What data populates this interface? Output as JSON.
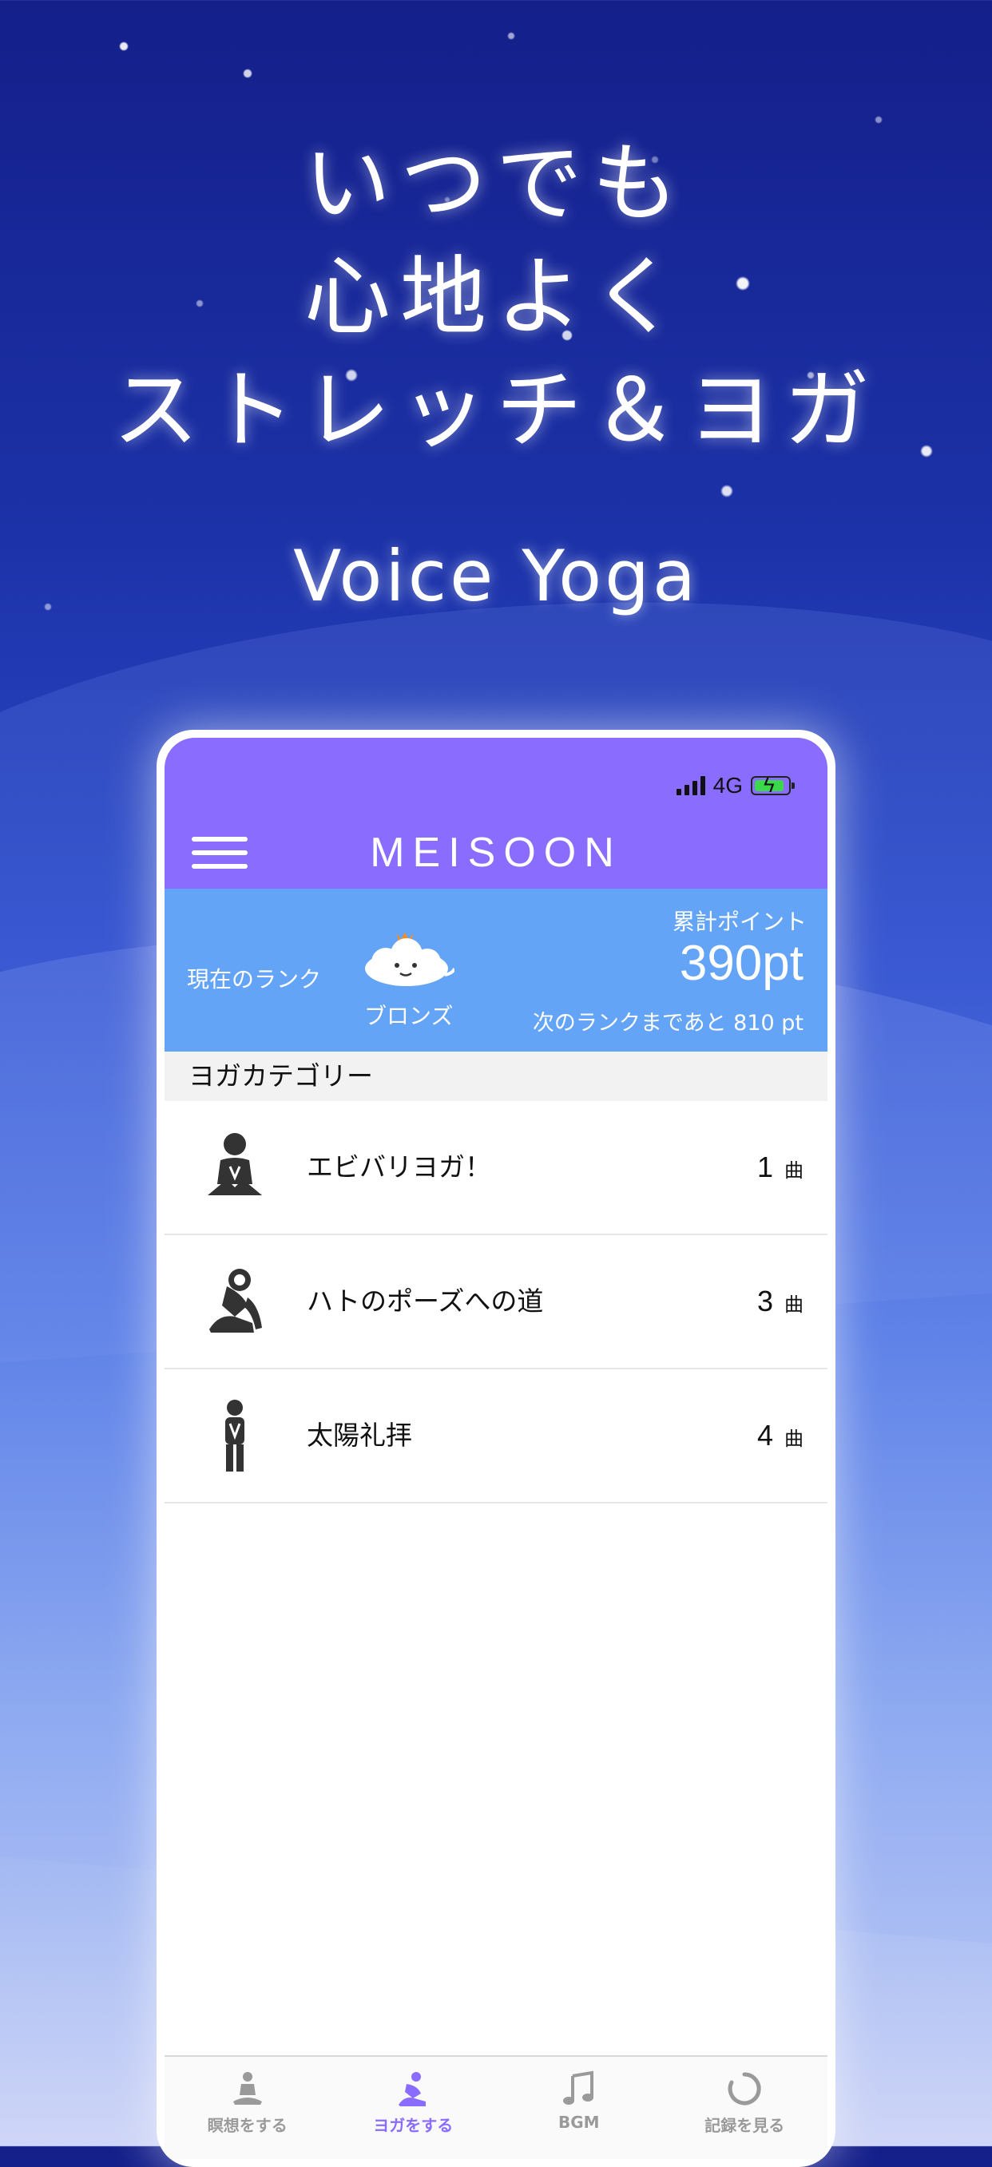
{
  "promo": {
    "headline_lines": [
      "いつでも",
      "心地よく",
      "ストレッチ＆ヨガ"
    ],
    "subtitle": "Voice Yoga"
  },
  "status_bar": {
    "network": "4G"
  },
  "app": {
    "title": "MEISOON",
    "accent_color": "#8a6cff",
    "rank_panel_color": "#64a4f7"
  },
  "rank": {
    "label": "現在のランク",
    "rank_name": "ブロンズ",
    "points_label": "累計ポイント",
    "points_value": "390pt",
    "next_rank_text": "次のランクまであと 810 pt"
  },
  "section": {
    "title": "ヨガカテゴリー"
  },
  "categories": [
    {
      "title": "エビバリヨガ！",
      "count": "1",
      "unit": "曲",
      "icon": "kneeling-pose-icon"
    },
    {
      "title": "ハトのポーズへの道",
      "count": "3",
      "unit": "曲",
      "icon": "pigeon-pose-icon"
    },
    {
      "title": "太陽礼拝",
      "count": "4",
      "unit": "曲",
      "icon": "standing-prayer-pose-icon"
    }
  ],
  "tabs": [
    {
      "label": "瞑想をする",
      "icon": "meditation-icon",
      "active": false
    },
    {
      "label": "ヨガをする",
      "icon": "yoga-icon",
      "active": true
    },
    {
      "label": "BGM",
      "icon": "music-note-icon",
      "active": false
    },
    {
      "label": "記録を見る",
      "icon": "record-icon",
      "active": false
    }
  ]
}
